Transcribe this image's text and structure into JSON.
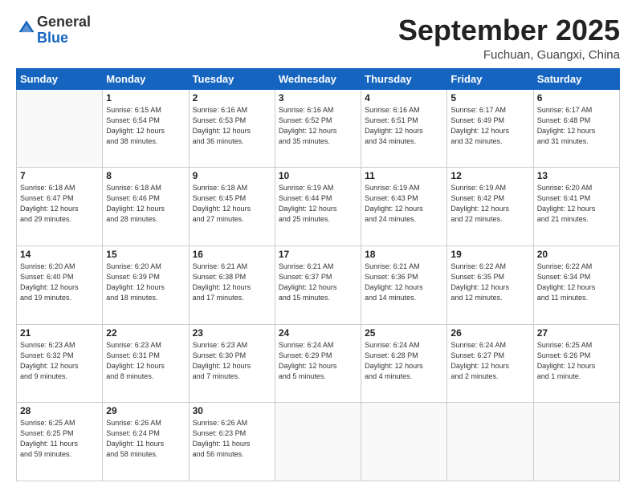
{
  "header": {
    "logo_general": "General",
    "logo_blue": "Blue",
    "month_title": "September 2025",
    "location": "Fuchuan, Guangxi, China"
  },
  "weekdays": [
    "Sunday",
    "Monday",
    "Tuesday",
    "Wednesday",
    "Thursday",
    "Friday",
    "Saturday"
  ],
  "weeks": [
    [
      {
        "day": "",
        "info": ""
      },
      {
        "day": "1",
        "info": "Sunrise: 6:15 AM\nSunset: 6:54 PM\nDaylight: 12 hours\nand 38 minutes."
      },
      {
        "day": "2",
        "info": "Sunrise: 6:16 AM\nSunset: 6:53 PM\nDaylight: 12 hours\nand 36 minutes."
      },
      {
        "day": "3",
        "info": "Sunrise: 6:16 AM\nSunset: 6:52 PM\nDaylight: 12 hours\nand 35 minutes."
      },
      {
        "day": "4",
        "info": "Sunrise: 6:16 AM\nSunset: 6:51 PM\nDaylight: 12 hours\nand 34 minutes."
      },
      {
        "day": "5",
        "info": "Sunrise: 6:17 AM\nSunset: 6:49 PM\nDaylight: 12 hours\nand 32 minutes."
      },
      {
        "day": "6",
        "info": "Sunrise: 6:17 AM\nSunset: 6:48 PM\nDaylight: 12 hours\nand 31 minutes."
      }
    ],
    [
      {
        "day": "7",
        "info": "Sunrise: 6:18 AM\nSunset: 6:47 PM\nDaylight: 12 hours\nand 29 minutes."
      },
      {
        "day": "8",
        "info": "Sunrise: 6:18 AM\nSunset: 6:46 PM\nDaylight: 12 hours\nand 28 minutes."
      },
      {
        "day": "9",
        "info": "Sunrise: 6:18 AM\nSunset: 6:45 PM\nDaylight: 12 hours\nand 27 minutes."
      },
      {
        "day": "10",
        "info": "Sunrise: 6:19 AM\nSunset: 6:44 PM\nDaylight: 12 hours\nand 25 minutes."
      },
      {
        "day": "11",
        "info": "Sunrise: 6:19 AM\nSunset: 6:43 PM\nDaylight: 12 hours\nand 24 minutes."
      },
      {
        "day": "12",
        "info": "Sunrise: 6:19 AM\nSunset: 6:42 PM\nDaylight: 12 hours\nand 22 minutes."
      },
      {
        "day": "13",
        "info": "Sunrise: 6:20 AM\nSunset: 6:41 PM\nDaylight: 12 hours\nand 21 minutes."
      }
    ],
    [
      {
        "day": "14",
        "info": "Sunrise: 6:20 AM\nSunset: 6:40 PM\nDaylight: 12 hours\nand 19 minutes."
      },
      {
        "day": "15",
        "info": "Sunrise: 6:20 AM\nSunset: 6:39 PM\nDaylight: 12 hours\nand 18 minutes."
      },
      {
        "day": "16",
        "info": "Sunrise: 6:21 AM\nSunset: 6:38 PM\nDaylight: 12 hours\nand 17 minutes."
      },
      {
        "day": "17",
        "info": "Sunrise: 6:21 AM\nSunset: 6:37 PM\nDaylight: 12 hours\nand 15 minutes."
      },
      {
        "day": "18",
        "info": "Sunrise: 6:21 AM\nSunset: 6:36 PM\nDaylight: 12 hours\nand 14 minutes."
      },
      {
        "day": "19",
        "info": "Sunrise: 6:22 AM\nSunset: 6:35 PM\nDaylight: 12 hours\nand 12 minutes."
      },
      {
        "day": "20",
        "info": "Sunrise: 6:22 AM\nSunset: 6:34 PM\nDaylight: 12 hours\nand 11 minutes."
      }
    ],
    [
      {
        "day": "21",
        "info": "Sunrise: 6:23 AM\nSunset: 6:32 PM\nDaylight: 12 hours\nand 9 minutes."
      },
      {
        "day": "22",
        "info": "Sunrise: 6:23 AM\nSunset: 6:31 PM\nDaylight: 12 hours\nand 8 minutes."
      },
      {
        "day": "23",
        "info": "Sunrise: 6:23 AM\nSunset: 6:30 PM\nDaylight: 12 hours\nand 7 minutes."
      },
      {
        "day": "24",
        "info": "Sunrise: 6:24 AM\nSunset: 6:29 PM\nDaylight: 12 hours\nand 5 minutes."
      },
      {
        "day": "25",
        "info": "Sunrise: 6:24 AM\nSunset: 6:28 PM\nDaylight: 12 hours\nand 4 minutes."
      },
      {
        "day": "26",
        "info": "Sunrise: 6:24 AM\nSunset: 6:27 PM\nDaylight: 12 hours\nand 2 minutes."
      },
      {
        "day": "27",
        "info": "Sunrise: 6:25 AM\nSunset: 6:26 PM\nDaylight: 12 hours\nand 1 minute."
      }
    ],
    [
      {
        "day": "28",
        "info": "Sunrise: 6:25 AM\nSunset: 6:25 PM\nDaylight: 11 hours\nand 59 minutes."
      },
      {
        "day": "29",
        "info": "Sunrise: 6:26 AM\nSunset: 6:24 PM\nDaylight: 11 hours\nand 58 minutes."
      },
      {
        "day": "30",
        "info": "Sunrise: 6:26 AM\nSunset: 6:23 PM\nDaylight: 11 hours\nand 56 minutes."
      },
      {
        "day": "",
        "info": ""
      },
      {
        "day": "",
        "info": ""
      },
      {
        "day": "",
        "info": ""
      },
      {
        "day": "",
        "info": ""
      }
    ]
  ]
}
